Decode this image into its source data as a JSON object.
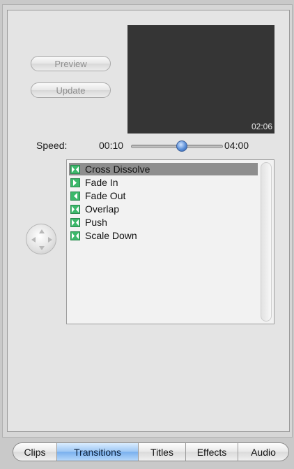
{
  "buttons": {
    "preview_label": "Preview",
    "update_label": "Update"
  },
  "preview": {
    "time": "02:06"
  },
  "speed": {
    "label": "Speed:",
    "min": "00:10",
    "max": "04:00",
    "slider_fraction": 0.55
  },
  "transitions": {
    "items": [
      {
        "label": "Cross Dissolve",
        "icon": "both-arrows-icon",
        "selected": true
      },
      {
        "label": "Fade In",
        "icon": "right-arrow-icon",
        "selected": false
      },
      {
        "label": "Fade Out",
        "icon": "left-arrow-icon",
        "selected": false
      },
      {
        "label": "Overlap",
        "icon": "both-arrows-icon",
        "selected": false
      },
      {
        "label": "Push",
        "icon": "both-arrows-icon",
        "selected": false
      },
      {
        "label": "Scale Down",
        "icon": "both-arrows-icon",
        "selected": false
      }
    ]
  },
  "tabs": [
    {
      "label": "Clips",
      "active": false
    },
    {
      "label": "Transitions",
      "active": true
    },
    {
      "label": "Titles",
      "active": false
    },
    {
      "label": "Effects",
      "active": false
    },
    {
      "label": "Audio",
      "active": false
    }
  ],
  "colors": {
    "icon_green": "#3bb86a",
    "selection_gray": "#8e8e8e",
    "tab_active_blue": "#79b0ee",
    "preview_bg": "#353535"
  }
}
